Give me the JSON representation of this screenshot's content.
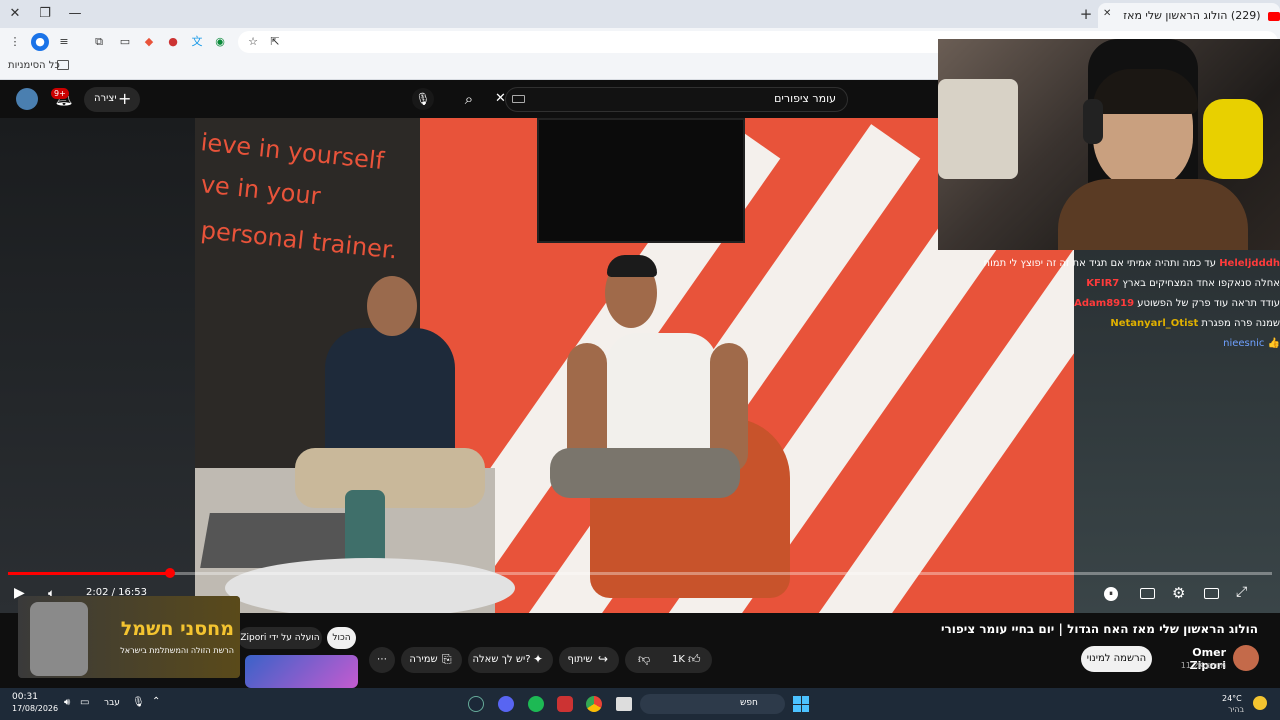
{
  "browser": {
    "tab_title": "(229) הולוג הראשון שלי מאז",
    "bookmarks_label": "כל הסימניות",
    "window_buttons": [
      "✕",
      "❐",
      "—"
    ]
  },
  "youtube": {
    "search_value": "עומר ציפורים",
    "create_label": "יצירה",
    "notifications_badge": "9+",
    "video_title": "הולוג הראשון שלי מאז האח הגדול | יום בחיי עומר ציפורי",
    "channel_name": "Omer Zipori",
    "subscribers": "11.2K מנויים",
    "subscribe_label": "הרשמה למינוי",
    "likes": "1K",
    "share_label": "שיתוף",
    "ask_label": "יש לך שאלה?",
    "save_label": "שמירה",
    "filter_all": "הכול",
    "filter_uploaded_by": "הועלה על ידי Zipori",
    "time_display": "2:02 / 16:53",
    "progress_fraction": 0.128,
    "wall_text": [
      "ieve in yourself",
      "ve in your",
      "personal trainer."
    ]
  },
  "stream_chat": [
    {
      "user": "Heleljdddh",
      "message": "עד כמה ותהיה אמיתי אם תגיד את זה זה יפוצץ לי תמוח",
      "color": "#ff3b3b"
    },
    {
      "user": "KFIR7",
      "message": "אחלה סנאקפו אחד המצחיקים בארץ",
      "color": "#ff3b3b"
    },
    {
      "user": "Adam8919",
      "message": "עודד תראה עוד פרק של הפשוטע",
      "color": "#ff3b3b"
    },
    {
      "user": "Netanyarl_Otist",
      "message": "שמנה פרה מפגרת",
      "color": "#e0b000"
    },
    {
      "user": "nieesnic",
      "message": "👍",
      "color": "#6fa0ff"
    }
  ],
  "sponsor": {
    "title": "מחסני חשמל",
    "subtitle": "הרשת הזולה והמשתלמת בישראל"
  },
  "taskbar": {
    "time": "00:31",
    "date": "17/08/2026",
    "language": "עבר",
    "search_label": "חפש",
    "weather_temp": "24°C",
    "weather_desc": "בהיר"
  },
  "colors": {
    "accent_red": "#ff0000",
    "wall_orange": "#e8533a",
    "taskbar": "#1e2a38"
  }
}
